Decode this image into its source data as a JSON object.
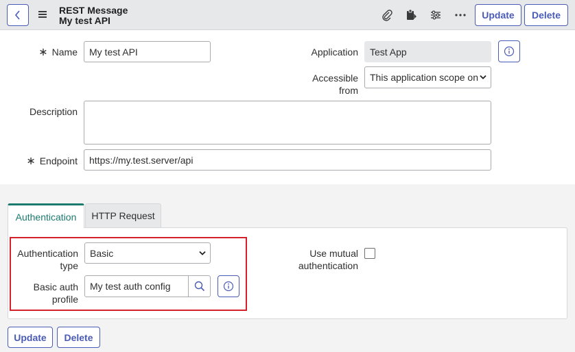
{
  "header": {
    "record_type": "REST Message",
    "record_name": "My test API",
    "update_label": "Update",
    "delete_label": "Delete"
  },
  "form": {
    "name": {
      "label": "Name",
      "value": "My test API"
    },
    "application": {
      "label": "Application",
      "value": "Test App"
    },
    "accessible_from": {
      "label_line1": "Accessible",
      "label_line2": "from",
      "value": "This application scope on"
    },
    "description": {
      "label": "Description",
      "value": ""
    },
    "endpoint": {
      "label": "Endpoint",
      "value": "https://my.test.server/api"
    }
  },
  "tabs": [
    {
      "label": "Authentication",
      "active": true
    },
    {
      "label": "HTTP Request",
      "active": false
    }
  ],
  "auth": {
    "type_label_line1": "Authentication",
    "type_label_line2": "type",
    "type_value": "Basic",
    "profile_label_line1": "Basic auth",
    "profile_label_line2": "profile",
    "profile_value": "My test auth config",
    "mutual_label_line1": "Use mutual",
    "mutual_label_line2": "authentication",
    "mutual_checked": false
  },
  "footer": {
    "update_label": "Update",
    "delete_label": "Delete"
  },
  "colors": {
    "accent": "#4a5bb5",
    "tab_active": "#1b7a6e",
    "highlight": "#d4202a",
    "header_bg": "#e7e8ea"
  },
  "icons": [
    "chevron-left-icon",
    "hamburger-menu-icon",
    "paperclip-icon",
    "clipboard-icon",
    "sliders-icon",
    "more-icon",
    "info-icon",
    "chevron-down-icon",
    "search-icon"
  ]
}
